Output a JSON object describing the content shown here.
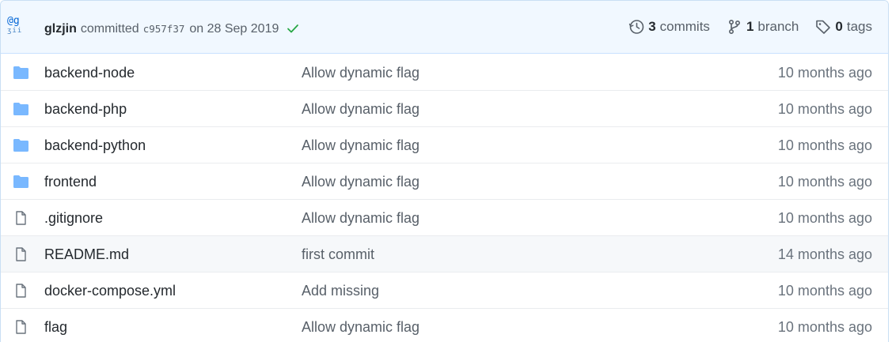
{
  "header": {
    "avatar_text": "@g",
    "avatar_sub": "ʒii",
    "author": "glzjin",
    "verb": "committed",
    "sha": "c957f37",
    "date": "on 28 Sep 2019",
    "status": "check-icon",
    "commits": {
      "count": "3",
      "label": "commits"
    },
    "branches": {
      "count": "1",
      "label": "branch"
    },
    "tags": {
      "count": "0",
      "label": "tags"
    }
  },
  "files": [
    {
      "type": "folder",
      "name": "backend-node",
      "message": "Allow dynamic flag",
      "age": "10 months ago"
    },
    {
      "type": "folder",
      "name": "backend-php",
      "message": "Allow dynamic flag",
      "age": "10 months ago"
    },
    {
      "type": "folder",
      "name": "backend-python",
      "message": "Allow dynamic flag",
      "age": "10 months ago"
    },
    {
      "type": "folder",
      "name": "frontend",
      "message": "Allow dynamic flag",
      "age": "10 months ago"
    },
    {
      "type": "file",
      "name": ".gitignore",
      "message": "Allow dynamic flag",
      "age": "10 months ago"
    },
    {
      "type": "file",
      "name": "README.md",
      "message": "first commit",
      "age": "14 months ago"
    },
    {
      "type": "file",
      "name": "docker-compose.yml",
      "message": "Add missing",
      "age": "10 months ago"
    },
    {
      "type": "file",
      "name": "flag",
      "message": "Allow dynamic flag",
      "age": "10 months ago"
    }
  ],
  "colors": {
    "folder": "#79b8ff",
    "check": "#28a745",
    "highlight_row": "#f6f8fa"
  }
}
